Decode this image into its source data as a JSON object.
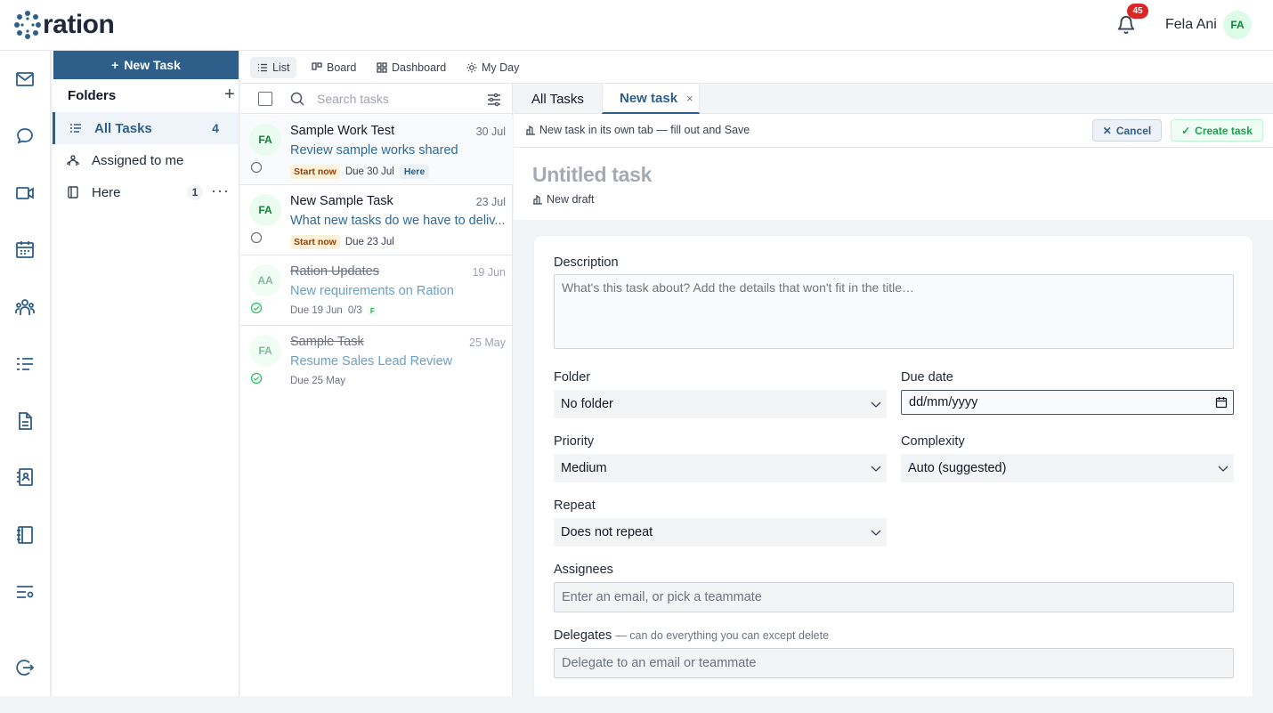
{
  "app": {
    "logo_text": "ration"
  },
  "header": {
    "notification_count": "45",
    "user_name": "Fela Ani",
    "user_initials": "FA"
  },
  "rail": {
    "items": [
      "mail-icon",
      "chat-icon",
      "video-icon",
      "calendar-icon",
      "people-icon",
      "tasks-icon",
      "document-icon",
      "contacts-icon",
      "notebook-icon",
      "settings-list-icon",
      "logout-icon"
    ]
  },
  "folders": {
    "new_task_label": "New Task",
    "title": "Folders",
    "add_label": "+",
    "items": [
      {
        "label": "All Tasks",
        "count": "4"
      },
      {
        "label": "Assigned to me",
        "count": ""
      },
      {
        "label": "Here",
        "count": "1",
        "more": "···"
      }
    ]
  },
  "views": {
    "tabs": [
      {
        "label": "List",
        "active": true
      },
      {
        "label": "Board"
      },
      {
        "label": "Dashboard"
      },
      {
        "label": "My Day"
      }
    ]
  },
  "tasklist": {
    "search_placeholder": "Search tasks",
    "tasks": [
      {
        "initials": "FA",
        "title": "Sample Work Test",
        "date": "30 Jul",
        "subtitle": "Review sample works shared",
        "badge": "Start now",
        "due": "Due 30 Jul",
        "tag": "Here",
        "done": false
      },
      {
        "initials": "FA",
        "title": "New Sample Task",
        "date": "23 Jul",
        "subtitle": "What new tasks do we have to deliv...",
        "badge": "Start now",
        "due": "Due 23 Jul",
        "done": false
      },
      {
        "initials": "AA",
        "title": "Ration Updates",
        "date": "19 Jun",
        "subtitle": "New requirements on Ration",
        "due": "Due 19 Jun",
        "progress": "0/3",
        "flag": "F",
        "done": true
      },
      {
        "initials": "FA",
        "title": "Sample Task",
        "date": "25 May",
        "subtitle": "Resume Sales Lead Review",
        "due": "Due 25 May",
        "done": true
      }
    ]
  },
  "detail": {
    "tabs": [
      {
        "label": "All Tasks"
      },
      {
        "label": "New task",
        "close": "×"
      }
    ],
    "hint": "New task in its own tab — fill out and Save",
    "cancel_label": "Cancel",
    "create_label": "Create task",
    "title_placeholder": "Untitled task",
    "draft_label": "New draft",
    "form": {
      "description_label": "Description",
      "description_placeholder": "What's this task about? Add the details that won't fit in the title…",
      "folder_label": "Folder",
      "folder_value": "No folder",
      "due_label": "Due date",
      "due_value": "dd/mm/yyyy",
      "priority_label": "Priority",
      "priority_value": "Medium",
      "complexity_label": "Complexity",
      "complexity_value": "Auto (suggested)",
      "repeat_label": "Repeat",
      "repeat_value": "Does not repeat",
      "assignees_label": "Assignees",
      "assignees_placeholder": "Enter an email, or pick a teammate",
      "delegates_label": "Delegates",
      "delegates_hint": "— can do everything you can except delete",
      "delegates_placeholder": "Delegate to an email or teammate"
    }
  },
  "colors": {
    "brand": "#2d5f8a",
    "success": "#16a34a",
    "danger": "#dc2626"
  }
}
